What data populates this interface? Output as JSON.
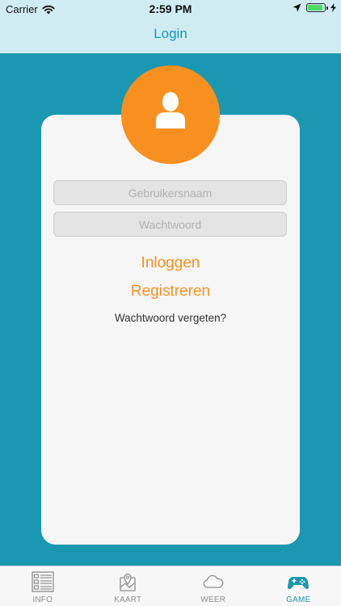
{
  "status_bar": {
    "carrier": "Carrier",
    "time": "2:59 PM",
    "battery_level": 0.9
  },
  "nav": {
    "title": "Login"
  },
  "login": {
    "username_placeholder": "Gebruikersnaam",
    "password_placeholder": "Wachtwoord",
    "login_label": "Inloggen",
    "register_label": "Registreren",
    "forgot_label": "Wachtwoord vergeten?"
  },
  "tabs": [
    {
      "label": "INFO",
      "icon": "list-icon",
      "active": false
    },
    {
      "label": "KAART",
      "icon": "map-icon",
      "active": false
    },
    {
      "label": "WEER",
      "icon": "cloud-icon",
      "active": false
    },
    {
      "label": "GAME",
      "icon": "gamepad-icon",
      "active": true
    }
  ],
  "colors": {
    "primary": "#1a98b1",
    "accent": "#f7901e",
    "nav_background": "#cfecf3",
    "card_background": "#f6f6f6"
  }
}
